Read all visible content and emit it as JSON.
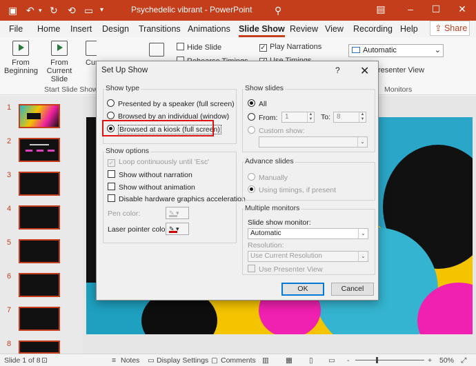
{
  "app": {
    "title": "Psychedelic vibrant  -  PowerPoint",
    "accent": "#c43e1c"
  },
  "title_bar_icons": [
    "save-icon",
    "undo-icon",
    "redo-icon",
    "reset-icon",
    "start-slideshow-icon",
    "search-icon",
    "restore-icon",
    "minimize-icon",
    "maximize-icon",
    "close-icon"
  ],
  "tabs": [
    "File",
    "Home",
    "Insert",
    "Design",
    "Transitions",
    "Animations",
    "Slide Show",
    "Review",
    "View",
    "Recording",
    "Help"
  ],
  "active_tab": "Slide Show",
  "share_label": "Share",
  "ribbon": {
    "from_beginning": "From Beginning",
    "from_current": "From Current Slide",
    "custom_partial": "Cus",
    "group_start": "Start Slide Show",
    "hide_slide": "Hide Slide",
    "rehearse_partial": "Rehearse Timings",
    "play_narrations": "Play Narrations",
    "use_timings_partial": "Use Timings",
    "monitor_value": "Automatic",
    "presenter_view_partial": "resenter View",
    "group_monitors": "Monitors"
  },
  "slides": {
    "numbers": [
      "1",
      "2",
      "3",
      "4",
      "5",
      "6",
      "7",
      "8"
    ],
    "slide1_text": "",
    "slide2_text": ""
  },
  "dialog": {
    "title": "Set Up Show",
    "help": "?",
    "close": "✕",
    "show_type_legend": "Show type",
    "show_type_options": [
      "Presented by a speaker (full screen)",
      "Browsed by an individual (window)",
      "Browsed at a kiosk (full screen)"
    ],
    "show_type_selected": "Browsed at a kiosk (full screen)",
    "highlight_color": "#e01010",
    "show_options_legend": "Show options",
    "show_options": [
      {
        "label": "Loop continuously until 'Esc'",
        "checked": true,
        "disabled": true
      },
      {
        "label": "Show without narration",
        "checked": false,
        "disabled": false
      },
      {
        "label": "Show without animation",
        "checked": false,
        "disabled": false
      },
      {
        "label": "Disable hardware graphics acceleration",
        "checked": false,
        "disabled": false
      }
    ],
    "pen_color_label": "Pen color:",
    "laser_color_label": "Laser pointer color:",
    "laser_color": "#cc0000",
    "show_slides_legend": "Show slides",
    "all_label": "All",
    "from_label": "From:",
    "from_value": "1",
    "to_label": "To:",
    "to_value": "8",
    "custom_show_label": "Custom show:",
    "advance_legend": "Advance slides",
    "manually_label": "Manually",
    "using_timings_label": "Using timings, if present",
    "monitors_legend": "Multiple monitors",
    "monitor_label": "Slide show monitor:",
    "monitor_value": "Automatic",
    "resolution_label": "Resolution:",
    "resolution_value": "Use Current Resolution",
    "presenter_view_label": "Use Presenter View",
    "ok_label": "OK",
    "cancel_label": "Cancel"
  },
  "status": {
    "slide_of": "Slide 1 of 8",
    "notes": "Notes",
    "display_settings": "Display Settings",
    "comments": "Comments",
    "zoom_minus": "-",
    "zoom_plus": "+",
    "zoom": "50%"
  }
}
